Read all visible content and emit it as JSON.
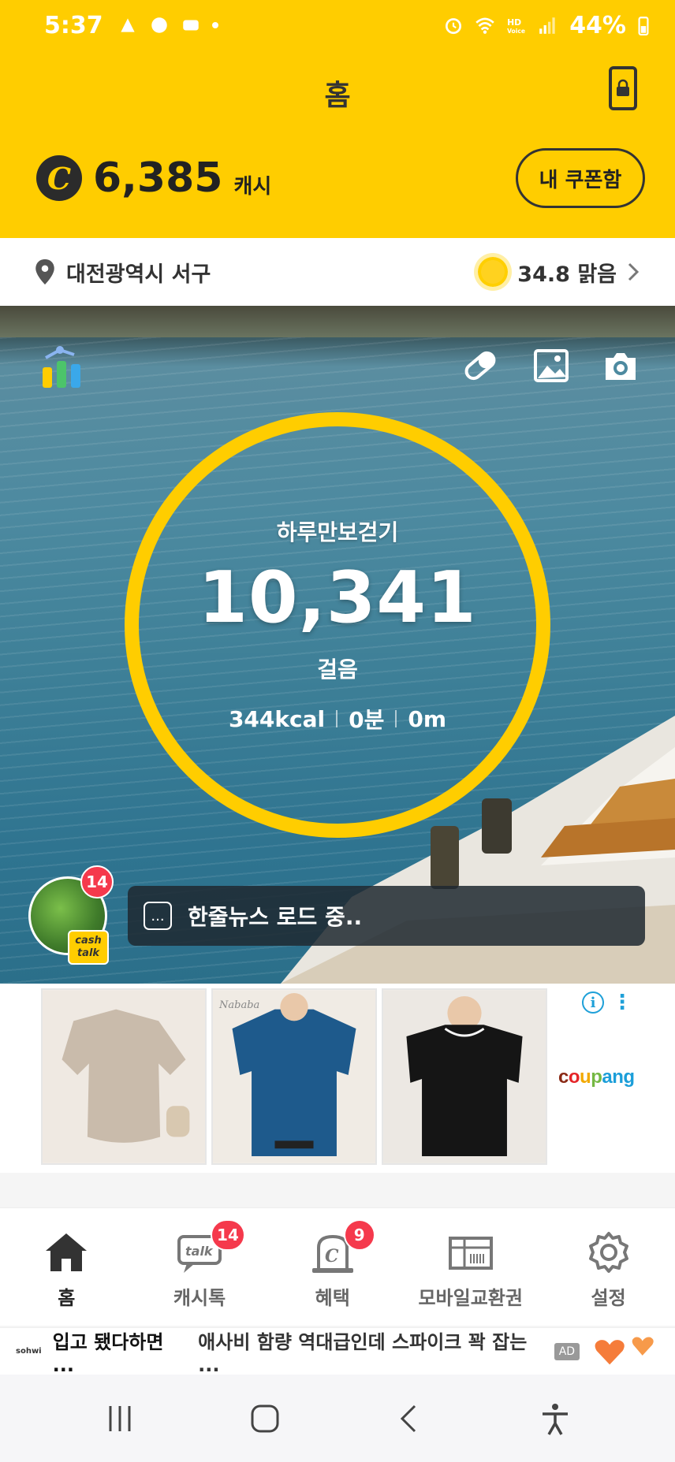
{
  "status_bar": {
    "time": "5:37",
    "battery": "44%"
  },
  "header": {
    "title": "홈",
    "cash_amount": "6,385",
    "cash_unit": "캐시",
    "coupon_button": "내 쿠폰함"
  },
  "location": {
    "place": "대전광역시 서구",
    "weather": "34.8 맑음"
  },
  "walk": {
    "label": "하루만보걷기",
    "steps": "10,341",
    "unit": "걸음",
    "stats": {
      "kcal": "344kcal",
      "minutes": "0분",
      "distance": "0m"
    }
  },
  "cashtalk": {
    "badge": "14",
    "tag_line1": "cash",
    "tag_line2": "talk",
    "news": "한줄뉴스 로드 중..",
    "news_dots": "..."
  },
  "ad": {
    "brand": "coupang",
    "product_tags": [
      "Nababa"
    ]
  },
  "bottom_nav": [
    {
      "label": "홈",
      "badge": null
    },
    {
      "label": "캐시톡",
      "badge": "14"
    },
    {
      "label": "혜택",
      "badge": "9"
    },
    {
      "label": "모바일교환권",
      "badge": null
    },
    {
      "label": "설정",
      "badge": null
    }
  ],
  "ad_strip": {
    "logo": "sohwi",
    "headline": "입고 됐다하면 ...",
    "description": "애사비 함량 역대급인데 스파이크 꽉 잡는 ...",
    "tag": "AD"
  },
  "colors": {
    "brand_yellow": "#ffcd00",
    "badge_red": "#f5394c"
  }
}
